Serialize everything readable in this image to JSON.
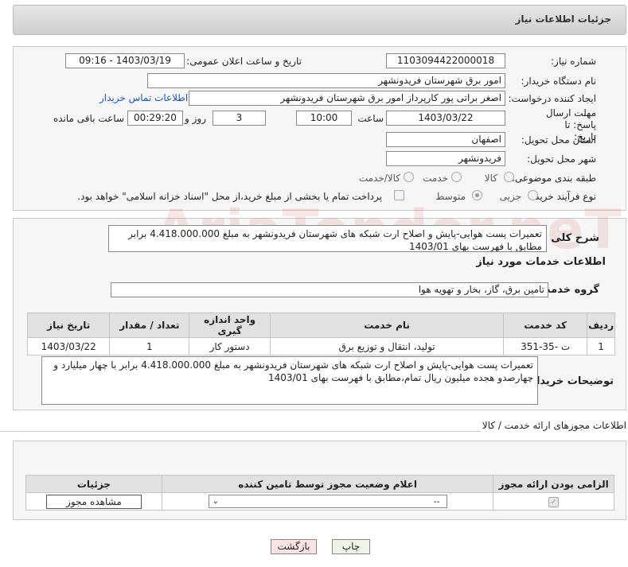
{
  "header": {
    "title": "جزئیات اطلاعات نیاز"
  },
  "form": {
    "need_number_label": "شماره نیاز:",
    "need_number": "1103094422000018",
    "announce_label": "تاریخ و ساعت اعلان عمومی:",
    "announce_value": "1403/03/19 - 09:16",
    "buyer_org_label": "نام دستگاه خریدار:",
    "buyer_org": "امور برق شهرستان فریدونشهر",
    "creator_label": "ایجاد کننده درخواست:",
    "creator": "اصغر براتی پور کارپرداز امور برق شهرستان فریدونشهر",
    "contact_link": "اطلاعات تماس خریدار",
    "deadline_label": "مهلت ارسال پاسخ: تا تاریخ:",
    "deadline_date": "1403/03/22",
    "time_label": "ساعت",
    "deadline_time": "10:00",
    "days_value": "3",
    "days_label": "روز و",
    "remaining_value": "00:29:20",
    "remaining_label": "ساعت باقی مانده",
    "province_label": "استان محل تحویل:",
    "province": "اصفهان",
    "city_label": "شهر محل تحویل:",
    "city": "فریدونشهر",
    "category_label": "طبقه بندی موضوعی:",
    "category_options": [
      "کالا",
      "خدمت",
      "کالا/خدمت"
    ],
    "process_label": "نوع فرآیند خرید :",
    "process_options": [
      "جزیی",
      "متوسط"
    ],
    "payment_note": "پرداخت تمام یا بخشی از مبلغ خرید،از محل \"اسناد خزانه اسلامی\" خواهد بود."
  },
  "summary": {
    "label": "شرح کلی نیاز:",
    "text": "تعمیرات پست هوایی-پایش و اصلاح ارت شبکه های شهرستان فریدونشهر به مبلغ 4.418.000.000 برابر مطابق با فهرست بهای 1403/01"
  },
  "services": {
    "section_title": "اطلاعات خدمات مورد نیاز",
    "group_label": "گروه خدمت:",
    "group_value": "تامین برق، گاز، بخار و تهویه هوا",
    "columns": [
      "ردیف",
      "کد خدمت",
      "نام خدمت",
      "واحد اندازه گیری",
      "تعداد / مقدار",
      "تاریخ نیاز"
    ],
    "rows": [
      {
        "idx": "1",
        "code": "ت -35-351",
        "name": "تولید، انتقال و توزیع برق",
        "unit": "دستور کار",
        "qty": "1",
        "date": "1403/03/22"
      }
    ]
  },
  "buyer_notes": {
    "label": "توضیحات خریدار:",
    "text": "تعمیرات پست هوایی-پایش و اصلاح ارت شبکه های شهرستان فریدونشهر به مبلغ 4.418.000.000 برابر با چهار میلیارد و چهارصدو هجده میلیون ریال تمام،مطابق با فهرست بهای 1403/01"
  },
  "permits": {
    "section_title": "اطلاعات مجوزهای ارائه خدمت / کالا",
    "columns": [
      "الزامی بودن ارائه مجوز",
      "اعلام وضعیت مجوز توسط تامین کننده",
      "جزئیات"
    ],
    "select_value": "--",
    "view_button": "مشاهده مجوز"
  },
  "footer": {
    "print_button": "چاپ",
    "back_button": "بازگشت"
  },
  "watermark": "AriaTender.neT",
  "colors": {
    "link": "#1a55c0",
    "back_button_bg": "#fbe3e3",
    "print_button_bg": "#eef5e8"
  }
}
